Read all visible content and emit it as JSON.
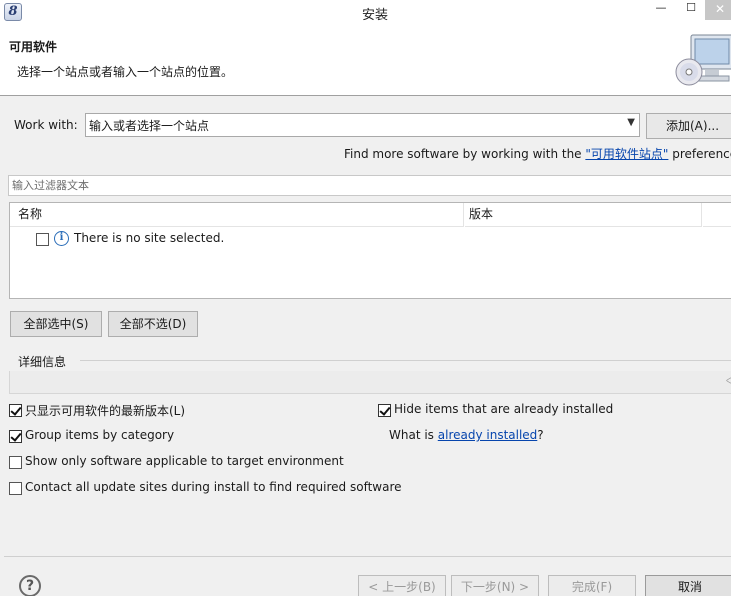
{
  "window": {
    "app_icon": "eclipse-icon",
    "title": "安装",
    "minimize_glyph": "—",
    "maximize_glyph": "☐",
    "close_glyph": "✕"
  },
  "banner": {
    "title": "可用软件",
    "description": "选择一个站点或者输入一个站点的位置。",
    "image_icon": "computer-cd-icon"
  },
  "work_with": {
    "label": "Work with:",
    "value": "输入或者选择一个站点",
    "add_button": "添加(A)..."
  },
  "find_more": {
    "prefix": "Find more software by working with the ",
    "link": "\"可用软件站点\"",
    "suffix": " preferences"
  },
  "filter": {
    "placeholder": "输入过滤器文本"
  },
  "tree": {
    "columns": [
      "名称",
      "版本"
    ],
    "rows": [
      {
        "checked": false,
        "icon": "info-icon",
        "text": "There is no site selected."
      }
    ]
  },
  "selection_buttons": {
    "select_all": "全部选中(S)",
    "deselect_all": "全部不选(D)"
  },
  "details": {
    "label": "详细信息"
  },
  "options": {
    "latest_only": {
      "label": "只显示可用软件的最新版本(L)",
      "checked": true
    },
    "hide_installed": {
      "label": "Hide items that are already installed",
      "checked": true
    },
    "group_by_category": {
      "label": "Group items by category",
      "checked": true
    },
    "what_is_prefix": "What is ",
    "what_is_link": "already installed",
    "what_is_suffix": "?",
    "target_env": {
      "label": "Show only software applicable to target environment",
      "checked": false
    },
    "contact_sites": {
      "label": "Contact all update sites during install to find required software",
      "checked": false
    }
  },
  "footer": {
    "help_icon": "help-icon",
    "back": "< 上一步(B)",
    "next": "下一步(N) >",
    "finish": "完成(F)",
    "cancel": "取消"
  }
}
